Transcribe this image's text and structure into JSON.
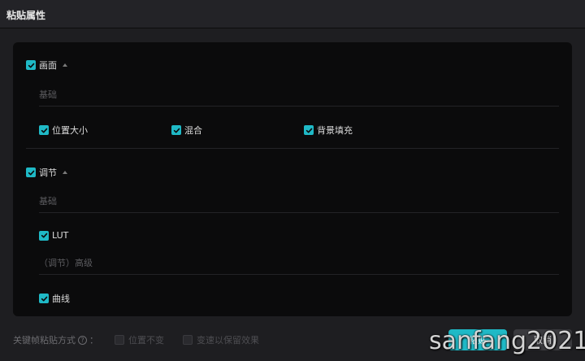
{
  "window": {
    "title": "粘贴属性"
  },
  "sections": [
    {
      "label": "画面",
      "checked": true,
      "groups": [
        {
          "label": "基础",
          "items": [
            "位置大小",
            "混合",
            "背景填充"
          ]
        }
      ]
    },
    {
      "label": "调节",
      "checked": true,
      "groups": [
        {
          "label": "基础",
          "items": [
            "LUT"
          ]
        },
        {
          "label": "（调节）高级",
          "items": [
            "曲线"
          ]
        }
      ]
    }
  ],
  "footer": {
    "keyframe_label": "关键帧粘贴方式",
    "help_symbol": "?",
    "colon": "：",
    "options": [
      "位置不变",
      "变速以保留效果"
    ],
    "ok": "粘贴",
    "cancel": "取消"
  },
  "watermark": "sanfang2021",
  "colors": {
    "accent": "#1fb9c6",
    "panel_bg": "#0b0b0c",
    "window_bg": "#1e1e21"
  }
}
